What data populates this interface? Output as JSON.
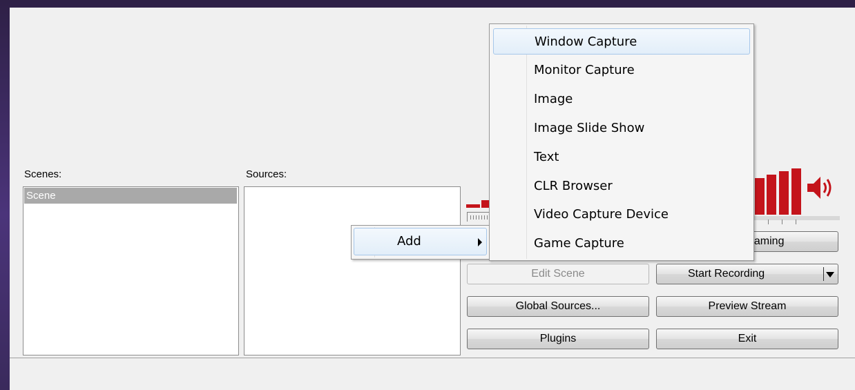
{
  "scenes": {
    "label": "Scenes:",
    "items": [
      "Scene"
    ]
  },
  "sources": {
    "label": "Sources:"
  },
  "buttons": {
    "streaming": "eaming",
    "edit_scene": "Edit Scene",
    "start_recording": "Start Recording",
    "global_sources": "Global Sources...",
    "preview_stream": "Preview Stream",
    "plugins": "Plugins",
    "exit": "Exit"
  },
  "context_menu": {
    "add": "Add"
  },
  "add_submenu": {
    "items": [
      "Window Capture",
      "Monitor Capture",
      "Image",
      "Image Slide Show",
      "Text",
      "CLR Browser",
      "Video Capture Device",
      "Game Capture"
    ],
    "highlighted": "Window Capture"
  },
  "colors": {
    "meter": "#c4141b",
    "selection": "#a9a9a9",
    "frame": "#3a2a5c"
  },
  "icons": [
    "speaker-icon",
    "submenu-arrow-icon",
    "dropdown-arrow-icon"
  ]
}
